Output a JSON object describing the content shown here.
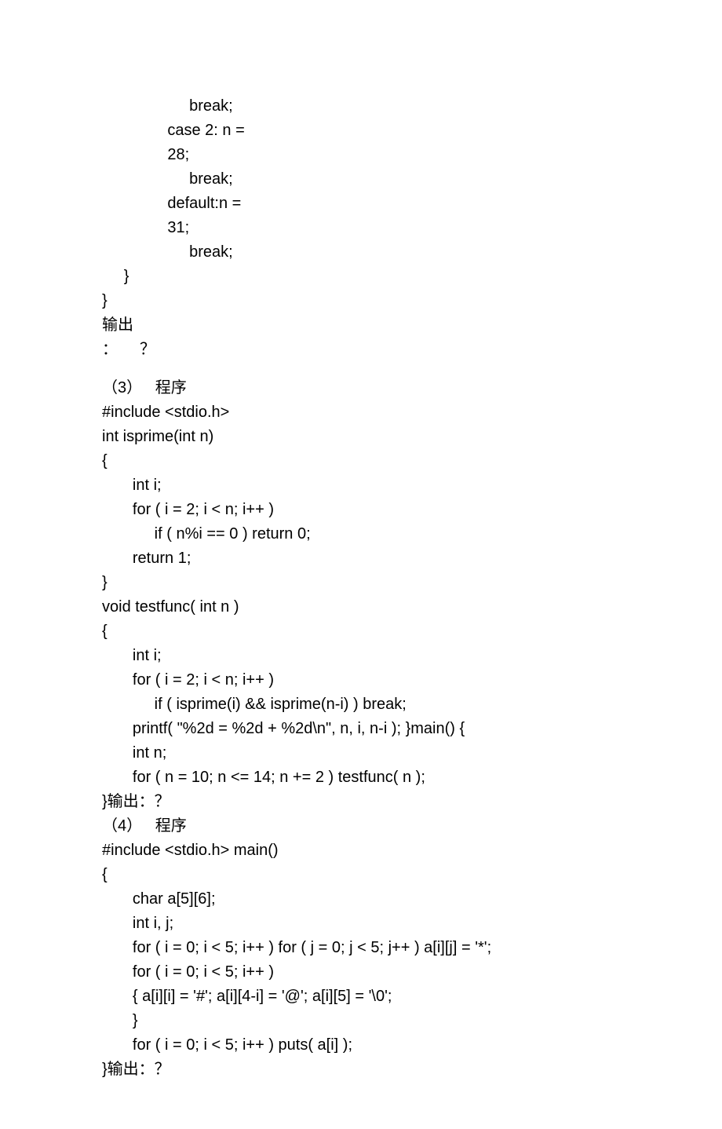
{
  "lines": {
    "l1": "                    break;",
    "l2": "               case 2: n =",
    "l3": "               28;",
    "l4": "                    break;",
    "l5": "               default:n =",
    "l6": "               31;",
    "l7": "                    break;",
    "l8": "     }",
    "l9": "}",
    "l10a": "输出",
    "l10b": "：",
    "l10c": "？",
    "l11a": "（3）",
    "l11b": "   程序",
    "l12": "#include <stdio.h>",
    "l13": "int isprime(int n)",
    "l14": "{",
    "l15": "       int i;",
    "l16": "       for ( i = 2; i < n; i++ )",
    "l17": "            if ( n%i == 0 ) return 0;",
    "l18": "       return 1;",
    "l19": "}",
    "l20": "void testfunc( int n )",
    "l21": "{",
    "l22": "       int i;",
    "l23": "       for ( i = 2; i < n; i++ )",
    "l24": "            if ( isprime(i) && isprime(n-i) ) break;",
    "l25": "       printf( \"%2d = %2d + %2d\\n\", n, i, n-i ); }main() {",
    "l26": "       int n;",
    "l27": "       for ( n = 10; n <= 14; n += 2 ) testfunc( n );",
    "l28": "}输出：？",
    "l29a": "（4）",
    "l29b": "   程序",
    "l30": "#include <stdio.h> main()",
    "l31": "{",
    "l32": "       char a[5][6];",
    "l33": "       int i, j;",
    "l34": "       for ( i = 0; i < 5; i++ ) for ( j = 0; j < 5; j++ ) a[i][j] = '*';",
    "l35": "       for ( i = 0; i < 5; i++ )",
    "l36": "       { a[i][i] = '#'; a[i][4-i] = '@'; a[i][5] = '\\0';",
    "l37": "       }",
    "l38": "       for ( i = 0; i < 5; i++ ) puts( a[i] );",
    "l39": "}输出：？"
  }
}
